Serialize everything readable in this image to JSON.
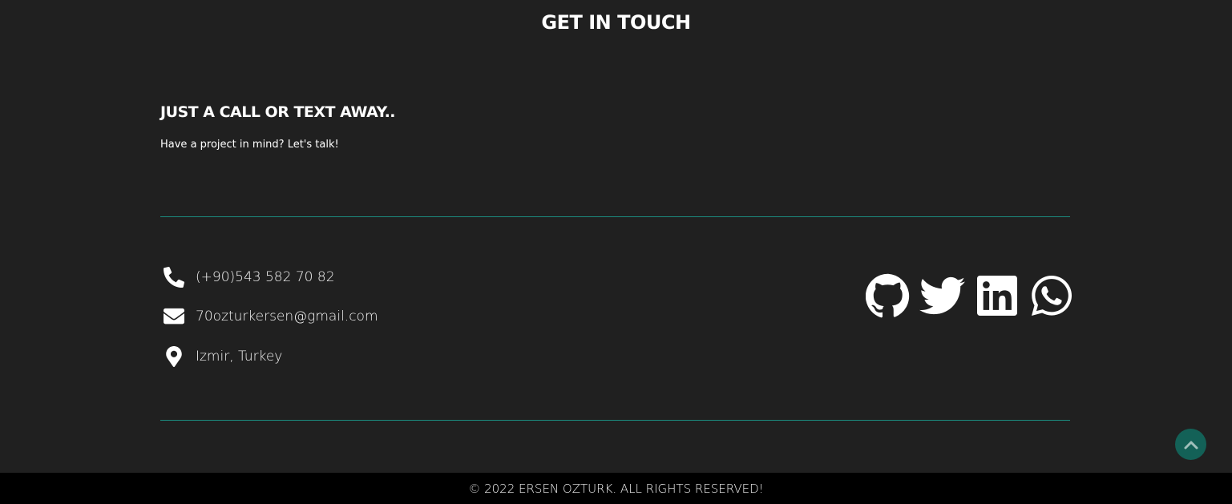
{
  "contact": {
    "title": "GET IN TOUCH",
    "subheading": "JUST A CALL OR TEXT AWAY..",
    "tagline": "Have a project in mind? Let's talk!",
    "phone": "(+90)543 582 70 82",
    "email": "70ozturkersen@gmail.com",
    "location": "Izmir, Turkey"
  },
  "socials": [
    {
      "name": "github",
      "icon": "github-icon"
    },
    {
      "name": "twitter",
      "icon": "twitter-icon"
    },
    {
      "name": "linkedin",
      "icon": "linkedin-icon"
    },
    {
      "name": "whatsapp",
      "icon": "whatsapp-icon"
    }
  ],
  "footer": {
    "copyright": "© 2022 ERSEN OZTURK. ALL RIGHTS RESERVED!"
  },
  "colors": {
    "background": "#202020",
    "accent": "#1b8a7e",
    "scroll_button": "#136157",
    "footer_bg": "#000000"
  }
}
